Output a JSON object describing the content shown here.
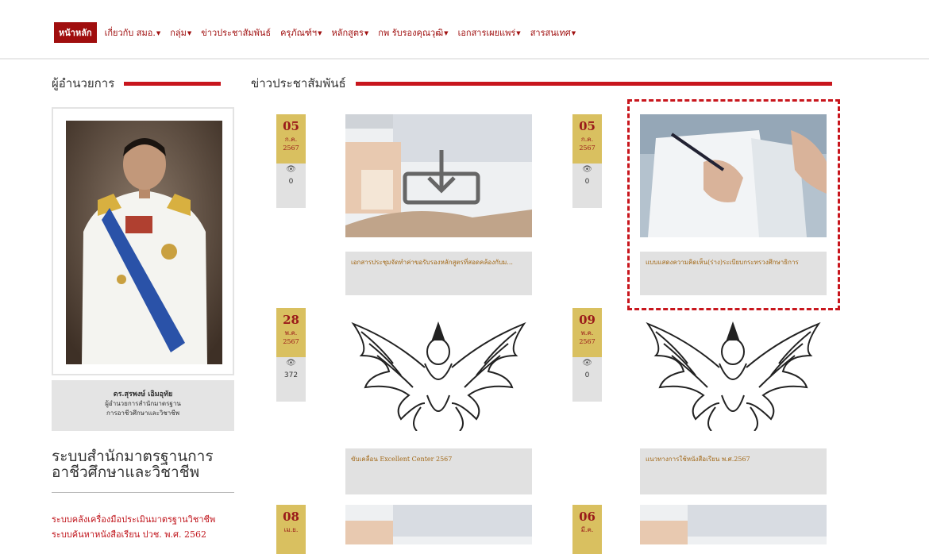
{
  "nav": {
    "items": [
      {
        "label": "หน้าหลัก",
        "dropdown": false,
        "active": true
      },
      {
        "label": "เกี่ยวกับ สมอ.",
        "dropdown": true
      },
      {
        "label": "กลุ่ม",
        "dropdown": true
      },
      {
        "label": "ข่าวประชาสัมพันธ์",
        "dropdown": false
      },
      {
        "label": "ครุภัณฑ์ฯ",
        "dropdown": true
      },
      {
        "label": "หลักสูตร",
        "dropdown": true
      },
      {
        "label": "กพ รับรองคุณวุฒิ",
        "dropdown": true
      },
      {
        "label": "เอกสารเผยแพร่",
        "dropdown": true
      },
      {
        "label": "สารสนเทศ",
        "dropdown": true
      }
    ],
    "caret": "▼"
  },
  "sidebar": {
    "heading": "ผู้อำนวยการ",
    "director_name": "ดร.สุรพงษ์ เอิมอุทัย",
    "director_title_1": "ผู้อำนวยการสำนักมาตรฐาน",
    "director_title_2": "การอาชีวศึกษาและวิชาชีพ",
    "system_title": "ระบบสำนักมาตรฐานการอาชีวศึกษาและวิชาชีพ",
    "links": [
      "ระบบคลังเครื่องมือประเมินมาตรฐานวิชาชีพ",
      "ระบบค้นหาหนังสือเรียน ปวช. พ.ศ. 2562"
    ]
  },
  "news": {
    "heading": "ข่าวประชาสัมพันธ์",
    "eye_icon": "👁",
    "items": [
      {
        "day": "05",
        "month": "ก.ค.",
        "year": "2567",
        "views": "0",
        "caption": "เอกสารประชุมจัดทำค่าขอรับรองหลักสูตรที่สอดคล้องกับม...",
        "image": "download"
      },
      {
        "day": "05",
        "month": "ก.ค.",
        "year": "2567",
        "views": "0",
        "caption": "แบบแสดงความคิดเห็น(ร่าง)ระเบียบกระทรวงศึกษาธิการ",
        "image": "signing"
      },
      {
        "day": "28",
        "month": "พ.ค.",
        "year": "2567",
        "views": "372",
        "caption": "ขับเคลื่อน Excellent Center 2567",
        "image": "garuda"
      },
      {
        "day": "09",
        "month": "พ.ค.",
        "year": "2567",
        "views": "0",
        "caption": "แนวทางการใช้หนังสือเรียน พ.ศ.2567",
        "image": "garuda"
      },
      {
        "day": "08",
        "month": "เม.ย.",
        "year": "",
        "views": "",
        "caption": "",
        "image": "download"
      },
      {
        "day": "06",
        "month": "มี.ค.",
        "year": "",
        "views": "",
        "caption": "",
        "image": "download"
      }
    ]
  },
  "colors": {
    "brand": "#a00e0e",
    "accent_bar": "#c8161d",
    "date_bg": "#d9c060",
    "caption_bg": "#e1e1e1"
  }
}
